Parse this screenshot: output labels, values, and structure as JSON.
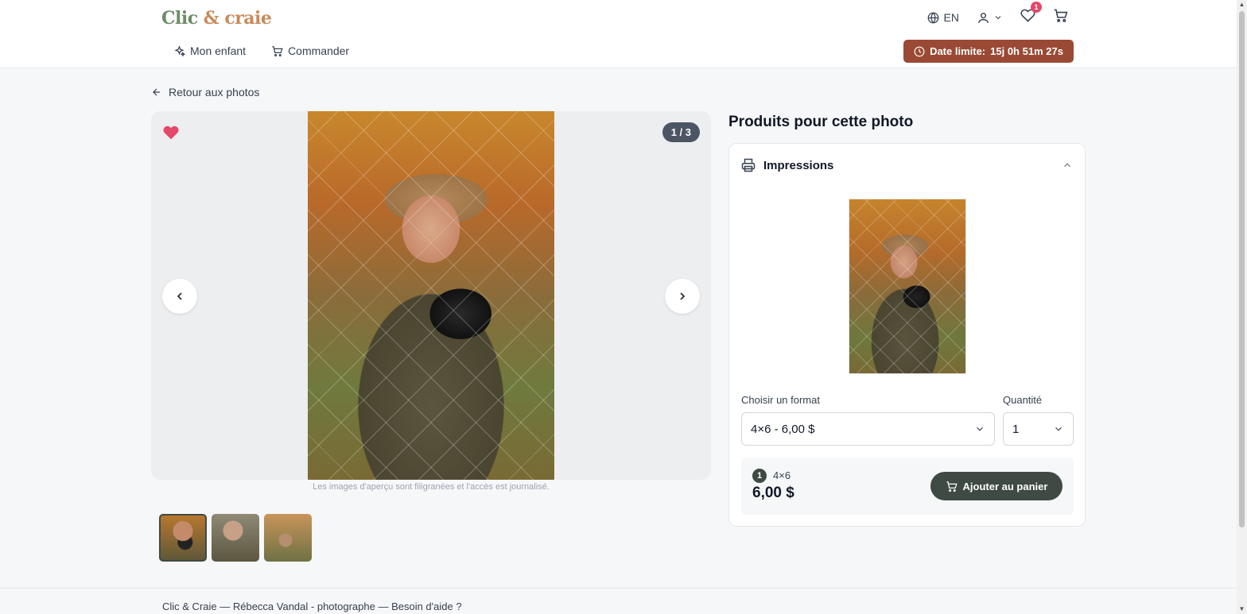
{
  "brand": {
    "name_part1": "Clic",
    "name_sep": " & ",
    "name_part2": "craie"
  },
  "header": {
    "language": "EN",
    "favorites_count": "1",
    "nav": [
      {
        "label": "Mon enfant",
        "icon": "sparkles-icon"
      },
      {
        "label": "Commander",
        "icon": "cart-icon"
      }
    ],
    "deadline_label": "Date limite:",
    "deadline_value": "15j 0h 51m 27s"
  },
  "back_label": "Retour aux photos",
  "viewer": {
    "counter": "1 / 3",
    "caption": "Les images d'aperçu sont filigranées et l'accès est journalisé.",
    "favorited": true,
    "thumbnails_count": 3
  },
  "products": {
    "title": "Produits pour cette photo",
    "section_label": "Impressions",
    "format_label": "Choisir un format",
    "format_value": "4×6 - 6,00 $",
    "quantity_label": "Quantité",
    "quantity_value": "1",
    "summary_count": "1",
    "summary_size": "4×6",
    "summary_price": "6,00 $",
    "add_button": "Ajouter au panier"
  },
  "footer": {
    "text": "Clic & Craie — Rébecca Vandal - photographe — Besoin d'aide ?"
  },
  "colors": {
    "accent": "#3f4a44",
    "deadline": "#9a4a34",
    "heart": "#e54868"
  }
}
